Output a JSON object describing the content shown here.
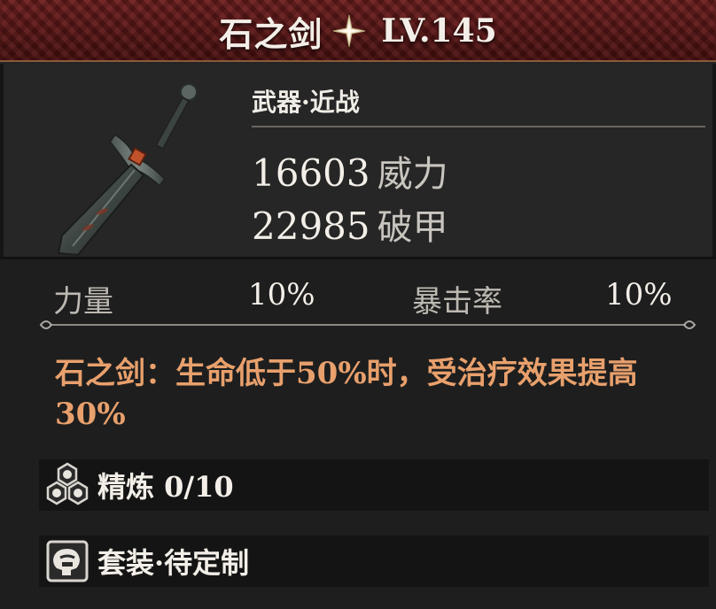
{
  "header": {
    "name": "石之剑",
    "star_icon": "sparkle-star-icon",
    "level": "LV.145",
    "color": "#5e1818"
  },
  "item": {
    "category": "武器·近战",
    "weapon_icon": "stone-sword-icon",
    "stats": [
      {
        "value": "16603",
        "label": "威力"
      },
      {
        "value": "22985",
        "label": "破甲"
      }
    ]
  },
  "attributes": [
    {
      "name": "力量",
      "value": "10%"
    },
    {
      "name": "暴击率",
      "value": "10%"
    }
  ],
  "effect": {
    "text": "石之剑：生命低于50%时，受治疗效果提高30%",
    "color": "#e8a06c"
  },
  "refine": {
    "icon": "hexagon-cluster-icon",
    "label": "精炼 0/10"
  },
  "set": {
    "icon": "armor-set-icon",
    "label": "套装·待定制"
  }
}
